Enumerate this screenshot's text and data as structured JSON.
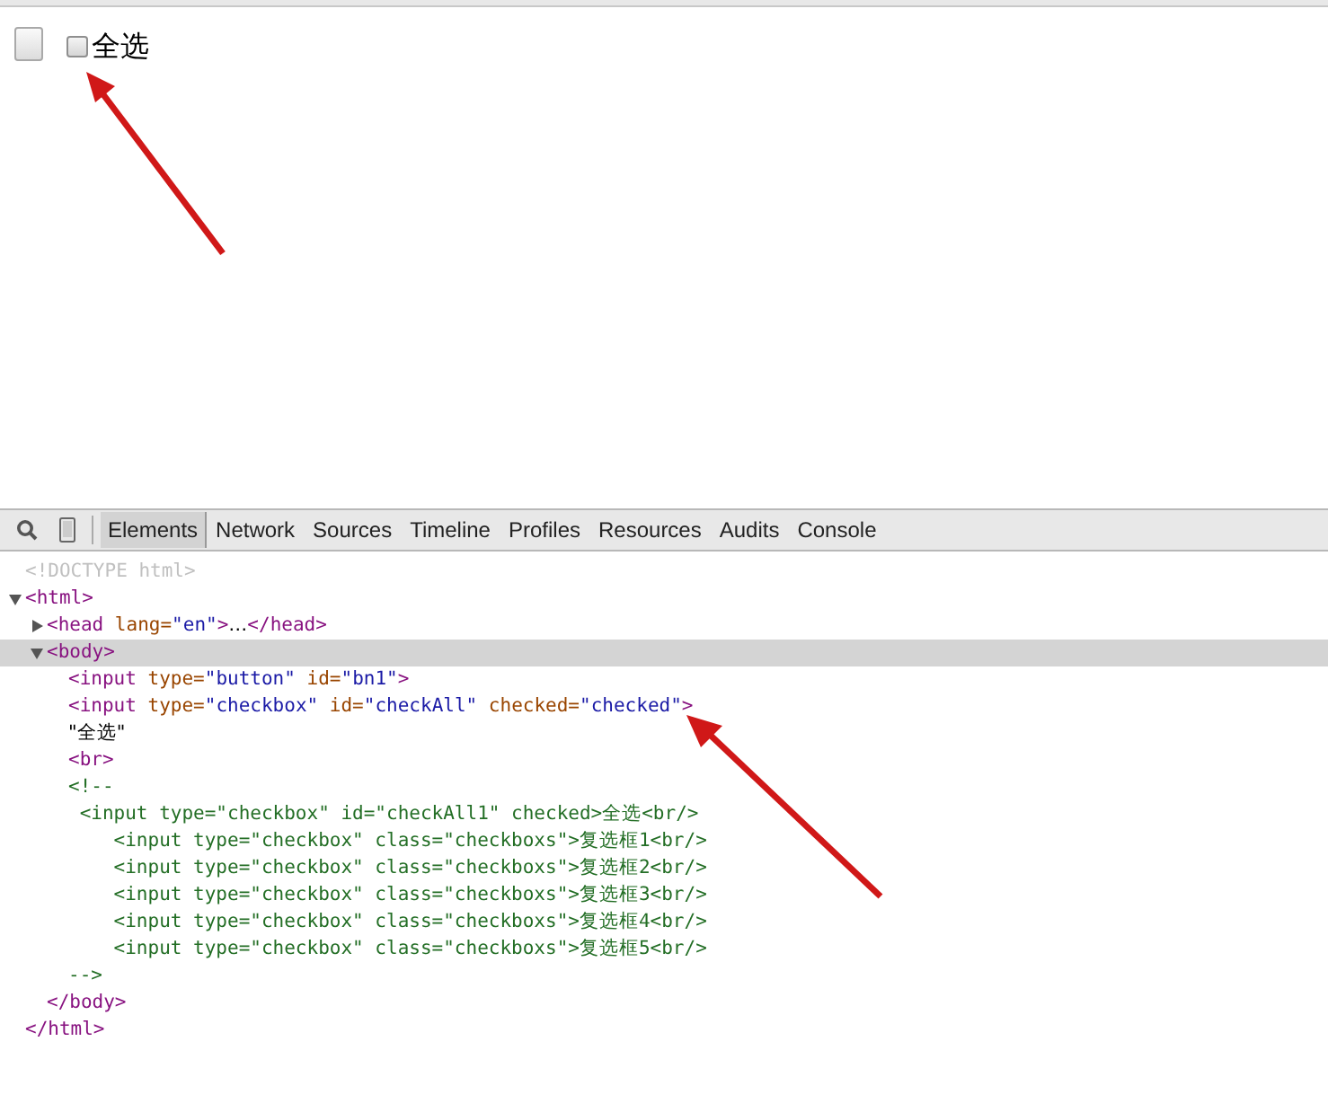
{
  "page": {
    "checkbox": {
      "checked": false,
      "label": "全选"
    }
  },
  "devtools": {
    "tabs": [
      {
        "label": "Elements",
        "selected": true
      },
      {
        "label": "Network",
        "selected": false
      },
      {
        "label": "Sources",
        "selected": false
      },
      {
        "label": "Timeline",
        "selected": false
      },
      {
        "label": "Profiles",
        "selected": false
      },
      {
        "label": "Resources",
        "selected": false
      },
      {
        "label": "Audits",
        "selected": false
      },
      {
        "label": "Console",
        "selected": false
      }
    ],
    "dom_tree": [
      {
        "kind": "doctype",
        "segments": [
          {
            "kind": "doctype",
            "text": "<!DOCTYPE html>"
          }
        ]
      },
      {
        "kind": "element",
        "expanded": true,
        "selected": false,
        "segments": [
          {
            "kind": "tag",
            "text": "<html>"
          }
        ],
        "children": [
          {
            "kind": "element",
            "expanded": false,
            "selected": false,
            "segments": [
              {
                "kind": "tag",
                "text": "<head"
              },
              {
                "kind": "attr",
                "text": " lang="
              },
              {
                "kind": "value",
                "text": "\"en\""
              },
              {
                "kind": "tag",
                "text": ">"
              },
              {
                "kind": "text",
                "text": "…"
              },
              {
                "kind": "tag",
                "text": "</head>"
              }
            ]
          },
          {
            "kind": "element",
            "expanded": true,
            "selected": true,
            "segments": [
              {
                "kind": "tag",
                "text": "<body>"
              }
            ],
            "children": [
              {
                "kind": "leaf",
                "segments": [
                  {
                    "kind": "tag",
                    "text": "<input"
                  },
                  {
                    "kind": "attr",
                    "text": " type="
                  },
                  {
                    "kind": "value",
                    "text": "\"button\""
                  },
                  {
                    "kind": "attr",
                    "text": " id="
                  },
                  {
                    "kind": "value",
                    "text": "\"bn1\""
                  },
                  {
                    "kind": "tag",
                    "text": ">"
                  }
                ]
              },
              {
                "kind": "leaf",
                "segments": [
                  {
                    "kind": "tag",
                    "text": "<input"
                  },
                  {
                    "kind": "attr",
                    "text": " type="
                  },
                  {
                    "kind": "value",
                    "text": "\"checkbox\""
                  },
                  {
                    "kind": "attr",
                    "text": " id="
                  },
                  {
                    "kind": "value",
                    "text": "\"checkAll\""
                  },
                  {
                    "kind": "attr",
                    "text": " checked="
                  },
                  {
                    "kind": "value",
                    "text": "\"checked\""
                  },
                  {
                    "kind": "tag",
                    "text": ">"
                  }
                ]
              },
              {
                "kind": "leaf",
                "segments": [
                  {
                    "kind": "text",
                    "text": "\"全选\""
                  }
                ]
              },
              {
                "kind": "leaf",
                "segments": [
                  {
                    "kind": "tag",
                    "text": "<br>"
                  }
                ]
              },
              {
                "kind": "comment",
                "lines": [
                  "<!--",
                  " <input type=\"checkbox\" id=\"checkAll1\" checked>全选<br/>",
                  "    <input type=\"checkbox\" class=\"checkboxs\">复选框1<br/>",
                  "    <input type=\"checkbox\" class=\"checkboxs\">复选框2<br/>",
                  "    <input type=\"checkbox\" class=\"checkboxs\">复选框3<br/>",
                  "    <input type=\"checkbox\" class=\"checkboxs\">复选框4<br/>",
                  "    <input type=\"checkbox\" class=\"checkboxs\">复选框5<br/>",
                  "-->"
                ]
              }
            ],
            "closing": [
              {
                "kind": "tag",
                "text": "</body>"
              }
            ]
          }
        ],
        "closing": [
          {
            "kind": "tag",
            "text": "</html>"
          }
        ]
      }
    ]
  }
}
